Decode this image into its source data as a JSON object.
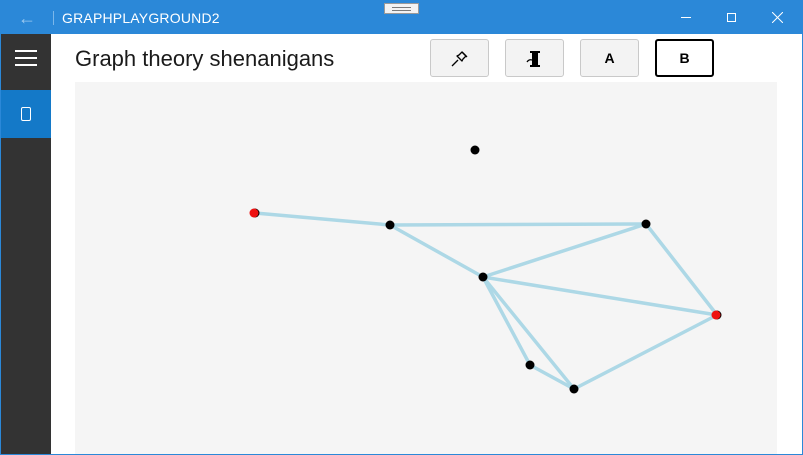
{
  "window": {
    "app_title": "GRAPHPLAYGROUND2",
    "accent_color": "#2b88d8"
  },
  "nav": {
    "menu_icon": "hamburger-icon",
    "active_item_icon": "page-icon",
    "active_color": "#1479c8",
    "pane_color": "#333333"
  },
  "header": {
    "page_title": "Graph theory shenanigans"
  },
  "toolbar": {
    "buttons": [
      {
        "icon": "pushpin-icon",
        "label": ""
      },
      {
        "icon": "spool-icon",
        "label": ""
      },
      {
        "icon": "",
        "label": "A"
      },
      {
        "icon": "",
        "label": "B",
        "selected": true
      }
    ]
  },
  "graph": {
    "edge_color": "#add8e6",
    "node_color": "#000000",
    "highlight_color": "#ee1111",
    "nodes": [
      {
        "id": "n1",
        "highlighted": true
      },
      {
        "id": "n2",
        "highlighted": false
      },
      {
        "id": "n3",
        "highlighted": false
      },
      {
        "id": "n4",
        "highlighted": false
      },
      {
        "id": "n5",
        "highlighted": true
      },
      {
        "id": "n6",
        "highlighted": false
      },
      {
        "id": "n7",
        "highlighted": false
      },
      {
        "id": "n8",
        "highlighted": false
      }
    ],
    "edges": [
      [
        "n1",
        "n2"
      ],
      [
        "n2",
        "n3"
      ],
      [
        "n2",
        "n4"
      ],
      [
        "n3",
        "n4"
      ],
      [
        "n3",
        "n5"
      ],
      [
        "n4",
        "n5"
      ],
      [
        "n4",
        "n6"
      ],
      [
        "n4",
        "n7"
      ],
      [
        "n6",
        "n7"
      ],
      [
        "n7",
        "n5"
      ]
    ]
  }
}
